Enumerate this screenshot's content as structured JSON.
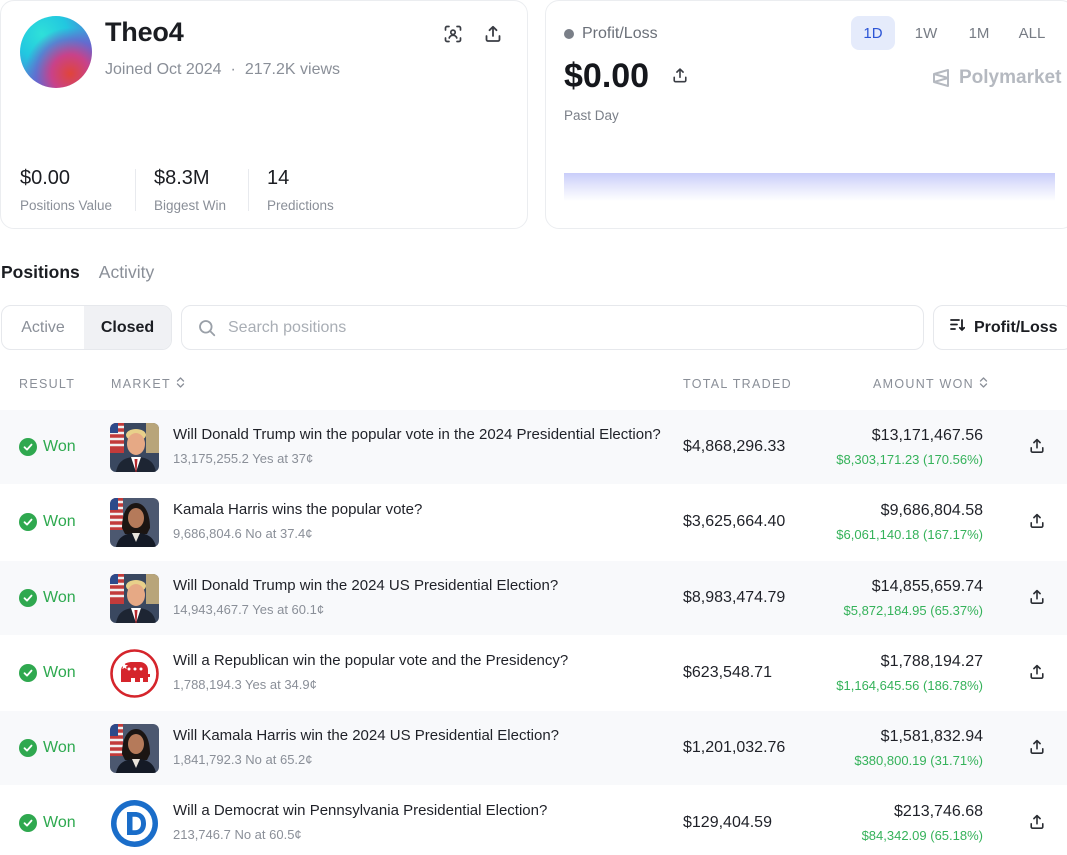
{
  "profile": {
    "username": "Theo4",
    "joined": "Joined Oct 2024",
    "views": "217.2K views",
    "stats": [
      {
        "value": "$0.00",
        "label": "Positions Value"
      },
      {
        "value": "$8.3M",
        "label": "Biggest Win"
      },
      {
        "value": "14",
        "label": "Predictions"
      }
    ]
  },
  "pnl": {
    "label": "Profit/Loss",
    "value": "$0.00",
    "period": "Past Day",
    "ranges": [
      "1D",
      "1W",
      "1M",
      "ALL"
    ],
    "active_range": "1D",
    "brand": "Polymarket"
  },
  "tabs": [
    "Positions",
    "Activity"
  ],
  "filters": {
    "segments": [
      "Active",
      "Closed"
    ],
    "active_segment": "Closed",
    "search_placeholder": "Search positions",
    "search_value": "",
    "sort_label": "Profit/Loss"
  },
  "table": {
    "headers": {
      "result": "RESULT",
      "market": "MARKET",
      "total_traded": "TOTAL TRADED",
      "amount_won": "AMOUNT WON"
    },
    "rows": [
      {
        "result": "Won",
        "thumb": "trump",
        "title": "Will Donald Trump win the popular vote in the 2024 Presidential Election?",
        "sub": "13,175,255.2 Yes at 37¢",
        "traded": "$4,868,296.33",
        "won": "$13,171,467.56",
        "profit": "$8,303,171.23 (170.56%)"
      },
      {
        "result": "Won",
        "thumb": "harris",
        "title": "Kamala Harris wins the popular vote?",
        "sub": "9,686,804.6 No at 37.4¢",
        "traded": "$3,625,664.40",
        "won": "$9,686,804.58",
        "profit": "$6,061,140.18 (167.17%)"
      },
      {
        "result": "Won",
        "thumb": "trump",
        "title": "Will Donald Trump win the 2024 US Presidential Election?",
        "sub": "14,943,467.7 Yes at 60.1¢",
        "traded": "$8,983,474.79",
        "won": "$14,855,659.74",
        "profit": "$5,872,184.95 (65.37%)"
      },
      {
        "result": "Won",
        "thumb": "republican",
        "title": "Will a Republican win the popular vote and the Presidency?",
        "sub": "1,788,194.3 Yes at 34.9¢",
        "traded": "$623,548.71",
        "won": "$1,788,194.27",
        "profit": "$1,164,645.56 (186.78%)"
      },
      {
        "result": "Won",
        "thumb": "harris",
        "title": "Will Kamala Harris win the 2024 US Presidential Election?",
        "sub": "1,841,792.3 No at 65.2¢",
        "traded": "$1,201,032.76",
        "won": "$1,581,832.94",
        "profit": "$380,800.19 (31.71%)"
      },
      {
        "result": "Won",
        "thumb": "democrat",
        "title": "Will a Democrat win Pennsylvania Presidential Election?",
        "sub": "213,746.7 No at 60.5¢",
        "traded": "$129,404.59",
        "won": "$213,746.68",
        "profit": "$84,342.09 (65.18%)"
      }
    ]
  },
  "colors": {
    "accent": "#2c55d6",
    "won_green": "#2ea94f",
    "profit_green": "#35b25a"
  }
}
